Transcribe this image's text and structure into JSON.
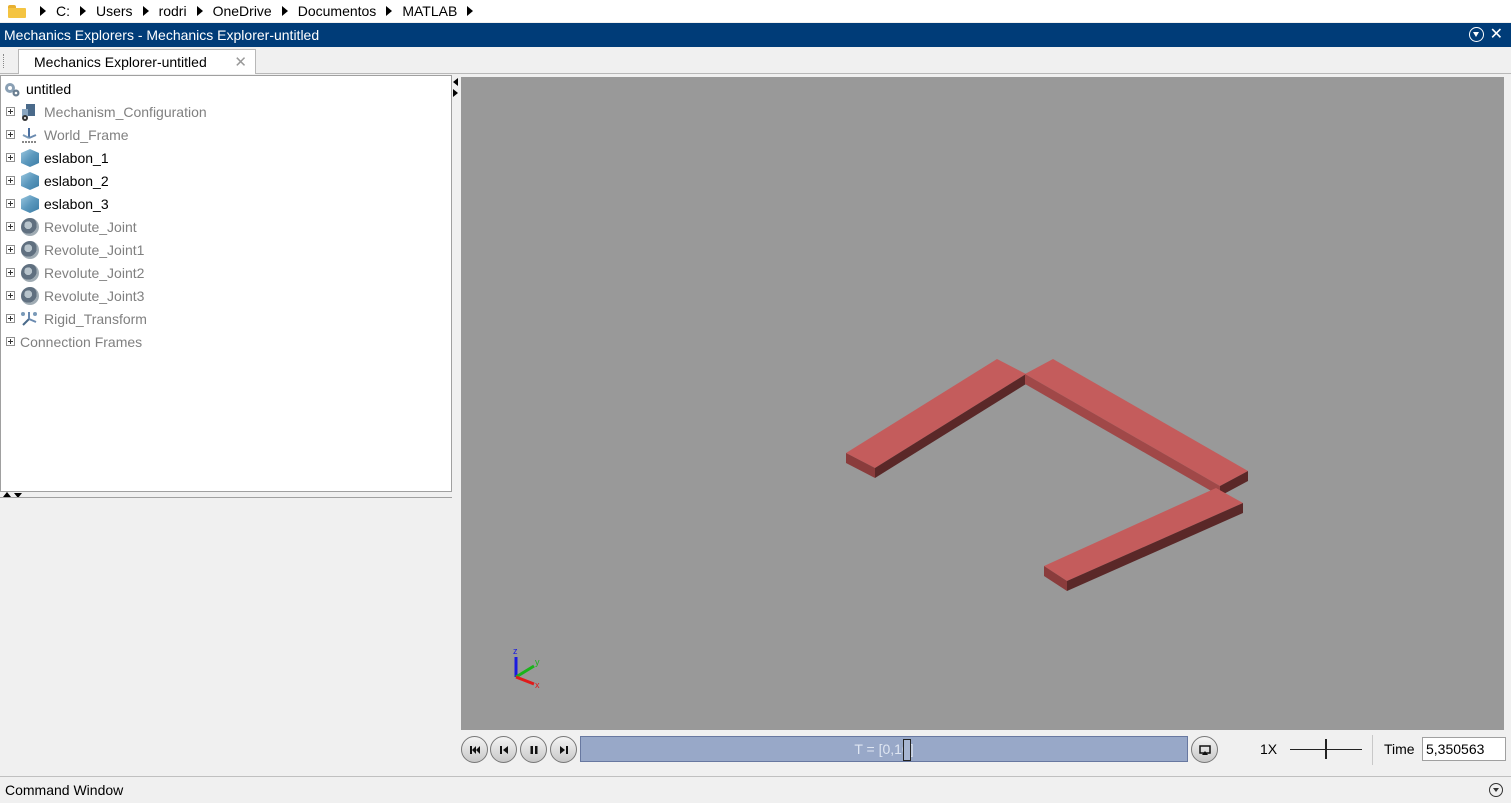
{
  "address_bar": {
    "folder_icon": "folder-icon",
    "crumbs": [
      "C:",
      "Users",
      "rodri",
      "OneDrive",
      "Documentos",
      "MATLAB"
    ]
  },
  "window": {
    "title": "Mechanics Explorers - Mechanics Explorer-untitled",
    "tab_label": "Mechanics Explorer-untitled"
  },
  "tree": {
    "root": "untitled",
    "items": [
      {
        "label": "Mechanism_Configuration",
        "icon": "mechanism-config-icon",
        "muted": true
      },
      {
        "label": "World_Frame",
        "icon": "world-frame-icon",
        "muted": true
      },
      {
        "label": "eslabon_1",
        "icon": "solid-cube-icon",
        "muted": false
      },
      {
        "label": "eslabon_2",
        "icon": "solid-cube-icon",
        "muted": false
      },
      {
        "label": "eslabon_3",
        "icon": "solid-cube-icon",
        "muted": false
      },
      {
        "label": "Revolute_Joint",
        "icon": "revolute-joint-icon",
        "muted": true
      },
      {
        "label": "Revolute_Joint1",
        "icon": "revolute-joint-icon",
        "muted": true
      },
      {
        "label": "Revolute_Joint2",
        "icon": "revolute-joint-icon",
        "muted": true
      },
      {
        "label": "Revolute_Joint3",
        "icon": "revolute-joint-icon",
        "muted": true
      },
      {
        "label": "Rigid_Transform",
        "icon": "rigid-transform-icon",
        "muted": true
      }
    ],
    "connection_frames": "Connection Frames"
  },
  "viewport": {
    "background": "#999999",
    "link_color": "#c45c5c",
    "triad": {
      "x": "x",
      "y": "y",
      "z": "z"
    }
  },
  "playback": {
    "timeline_label": "T = [0,10]",
    "speed_label": "1X",
    "time_label": "Time",
    "time_value": "5,350563"
  },
  "command_window": {
    "label": "Command Window"
  }
}
